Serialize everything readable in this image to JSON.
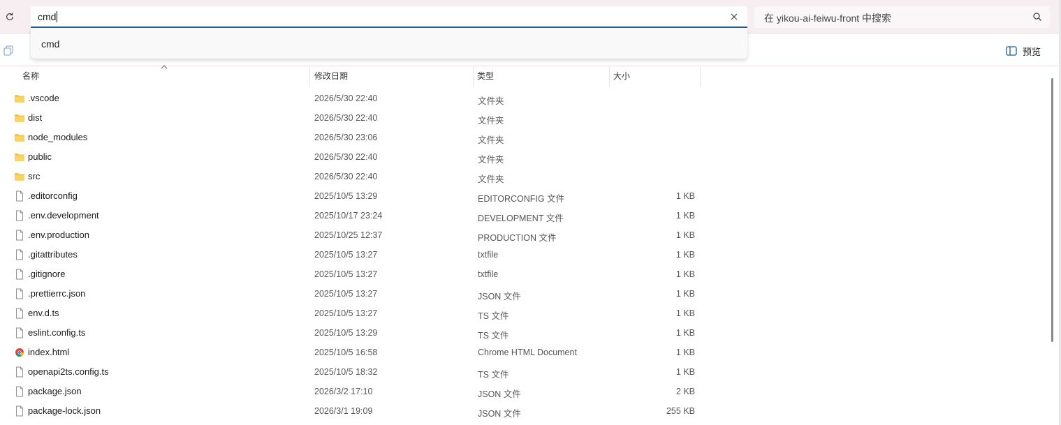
{
  "address_bar": {
    "value": "cmd"
  },
  "search": {
    "placeholder": "在 yikou-ai-feiwu-front 中搜索"
  },
  "suggestions": [
    "cmd"
  ],
  "toolbar": {
    "preview_label": "预览"
  },
  "columns": {
    "name": "名称",
    "date": "修改日期",
    "type": "类型",
    "size": "大小"
  },
  "files": [
    {
      "name": ".vscode",
      "date": "2026/5/30 22:40",
      "type": "文件夹",
      "size": "",
      "icon": "folder-icon"
    },
    {
      "name": "dist",
      "date": "2026/5/30 22:40",
      "type": "文件夹",
      "size": "",
      "icon": "folder-icon"
    },
    {
      "name": "node_modules",
      "date": "2026/5/30 23:06",
      "type": "文件夹",
      "size": "",
      "icon": "folder-icon"
    },
    {
      "name": "public",
      "date": "2026/5/30 22:40",
      "type": "文件夹",
      "size": "",
      "icon": "folder-icon"
    },
    {
      "name": "src",
      "date": "2026/5/30 22:40",
      "type": "文件夹",
      "size": "",
      "icon": "folder-icon"
    },
    {
      "name": ".editorconfig",
      "date": "2025/10/5 13:29",
      "type": "EDITORCONFIG 文件",
      "size": "1 KB",
      "icon": "file-icon"
    },
    {
      "name": ".env.development",
      "date": "2025/10/17 23:24",
      "type": "DEVELOPMENT 文件",
      "size": "1 KB",
      "icon": "file-icon"
    },
    {
      "name": ".env.production",
      "date": "2025/10/25 12:37",
      "type": "PRODUCTION 文件",
      "size": "1 KB",
      "icon": "file-icon"
    },
    {
      "name": ".gitattributes",
      "date": "2025/10/5 13:27",
      "type": "txtfile",
      "size": "1 KB",
      "icon": "file-icon"
    },
    {
      "name": ".gitignore",
      "date": "2025/10/5 13:27",
      "type": "txtfile",
      "size": "1 KB",
      "icon": "file-icon"
    },
    {
      "name": ".prettierrc.json",
      "date": "2025/10/5 13:27",
      "type": "JSON 文件",
      "size": "1 KB",
      "icon": "file-icon"
    },
    {
      "name": "env.d.ts",
      "date": "2025/10/5 13:27",
      "type": "TS 文件",
      "size": "1 KB",
      "icon": "file-icon"
    },
    {
      "name": "eslint.config.ts",
      "date": "2025/10/5 13:29",
      "type": "TS 文件",
      "size": "1 KB",
      "icon": "file-icon"
    },
    {
      "name": "index.html",
      "date": "2025/10/5 16:58",
      "type": "Chrome HTML Document",
      "size": "1 KB",
      "icon": "chrome-icon"
    },
    {
      "name": "openapi2ts.config.ts",
      "date": "2025/10/5 18:32",
      "type": "TS 文件",
      "size": "1 KB",
      "icon": "file-icon"
    },
    {
      "name": "package.json",
      "date": "2026/3/2 17:10",
      "type": "JSON 文件",
      "size": "2 KB",
      "icon": "file-icon"
    },
    {
      "name": "package-lock.json",
      "date": "2026/3/1 19:09",
      "type": "JSON 文件",
      "size": "255 KB",
      "icon": "file-icon"
    }
  ],
  "colors": {
    "accent": "#1f5f8f",
    "folder": "#f4c34a",
    "titlebar": "#f7eef1"
  }
}
